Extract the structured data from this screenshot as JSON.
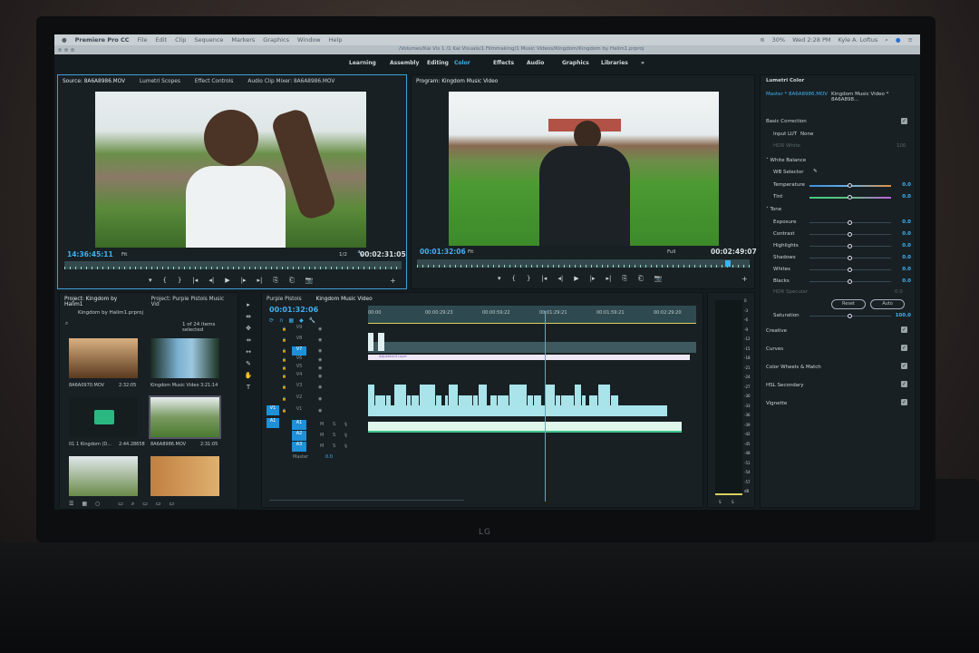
{
  "menubar": {
    "app": "Premiere Pro CC",
    "items": [
      "File",
      "Edit",
      "Clip",
      "Sequence",
      "Markers",
      "Graphics",
      "Window",
      "Help"
    ],
    "battery": "30%",
    "clock": "Wed 2:28 PM",
    "user": "Kyle A. Loftus"
  },
  "path": "/Volumes/Kai Vis 1 /1 Kai Visuals/1 Filmmaking/1 Music Videos/Kingdom/Kingdom by Halim1.prproj",
  "workspaces": [
    "Learning",
    "Assembly",
    "Editing",
    "Color",
    "Effects",
    "Audio",
    "Graphics",
    "Libraries",
    "»"
  ],
  "active_workspace": "Color",
  "source": {
    "tabs": [
      "Source: 8A6A8986.MOV",
      "Lumetri Scopes",
      "Effect Controls",
      "Audio Clip Mixer: 8A6A8986.MOV"
    ],
    "timecode": "14:36:45:11",
    "fit": "Fit",
    "resolution": "1/2",
    "duration": "00:02:31:05"
  },
  "program": {
    "tab": "Program: Kingdom Music Video",
    "timecode": "00:01:32:06",
    "fit": "Fit",
    "resolution": "Full",
    "duration": "00:02:49:07"
  },
  "transport": [
    "▾",
    "{",
    "}",
    "|◂",
    "◂|",
    "▶",
    "|▸",
    "▸|",
    "⎘",
    "⎗",
    "📷"
  ],
  "lumetri": {
    "title": "Lumetri Color",
    "master": "Master * 8A6A8986.MOV",
    "clip": "Kingdom Music Video * 8A6A898...",
    "basic": "Basic Correction",
    "input_lut_label": "Input LUT",
    "input_lut": "None",
    "hdr_white": "HDR White",
    "hdr_white_val": "100",
    "wb": "White Balance",
    "wb_selector": "WB Selector",
    "wb_sliders": [
      {
        "label": "Temperature",
        "value": "0.0",
        "pos": 0.5
      },
      {
        "label": "Tint",
        "value": "0.0",
        "pos": 0.5
      }
    ],
    "tone": "Tone",
    "tone_sliders": [
      {
        "label": "Exposure",
        "value": "0.0",
        "pos": 0.5
      },
      {
        "label": "Contrast",
        "value": "0.0",
        "pos": 0.5
      },
      {
        "label": "Highlights",
        "value": "0.0",
        "pos": 0.5
      },
      {
        "label": "Shadows",
        "value": "0.0",
        "pos": 0.5
      },
      {
        "label": "Whites",
        "value": "0.0",
        "pos": 0.5
      },
      {
        "label": "Blacks",
        "value": "0.0",
        "pos": 0.5
      }
    ],
    "hdr_specular": "HDR Specular",
    "hdr_specular_val": "0.0",
    "reset": "Reset",
    "auto": "Auto",
    "saturation": {
      "label": "Saturation",
      "value": "100.0",
      "pos": 0.5
    },
    "sections": [
      "Creative",
      "Curves",
      "Color Wheels & Match",
      "HSL Secondary",
      "Vignette"
    ]
  },
  "project": {
    "tabs": [
      "Project: Kingdom by Halim1",
      "Project: Purple Pistols Music Vid"
    ],
    "file": "Kingdom by Halim1.prproj",
    "selection": "1 of 24 items selected",
    "items": [
      {
        "name": "8A6A0970.MOV",
        "dur": "2:32:05"
      },
      {
        "name": "Kingdom Music Video",
        "dur": "3:21:14"
      },
      {
        "name": "01 1 Kingdom (D...",
        "dur": "2:44.28658"
      },
      {
        "name": "8A6A8986.MOV",
        "dur": "2:31:05"
      },
      {
        "name": "",
        "dur": ""
      },
      {
        "name": "",
        "dur": ""
      }
    ]
  },
  "timeline": {
    "tabs": [
      "Purple Pistols",
      "Kingdom Music Video"
    ],
    "timecode": "00:01:32:06",
    "ruler": [
      "00:00",
      "00:00:29:23",
      "00:00:59:22",
      "00:01:29:21",
      "00:01:59:21",
      "00:02:29:20"
    ],
    "video_tracks": [
      "V9",
      "V8",
      "V7",
      "V6",
      "V5",
      "V4",
      "V3",
      "V2",
      "V1"
    ],
    "audio_tracks": [
      "A1",
      "A2",
      "A3"
    ],
    "source_v": "V1",
    "source_a": "A1",
    "master": "Master",
    "master_val": "0.0",
    "ms": [
      "M",
      "S"
    ],
    "adjustment": "Adjustment Layer",
    "playhead": 0.54
  },
  "meter": {
    "ticks": [
      "0",
      "-3",
      "-6",
      "-9",
      "-12",
      "-15",
      "-18",
      "-21",
      "-24",
      "-27",
      "-30",
      "-33",
      "-36",
      "-39",
      "-42",
      "-45",
      "-48",
      "-51",
      "-54",
      "-57",
      "dB"
    ],
    "channels": [
      "S",
      "S"
    ]
  },
  "monitor_brand": "LG",
  "colors": {
    "accent": "#3fb1ef",
    "clip": "#a8e4ea",
    "audio": "#3ec48a",
    "panel": "#182024"
  }
}
